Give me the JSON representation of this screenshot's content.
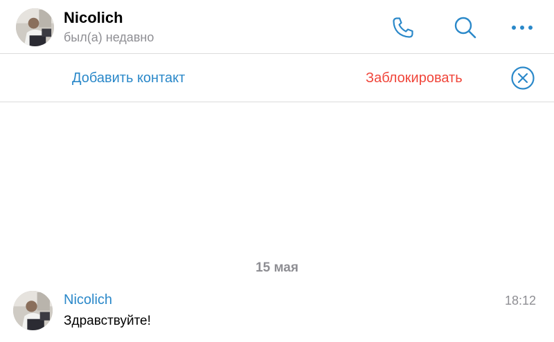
{
  "header": {
    "name": "Nicolich",
    "status": "был(а) недавно",
    "avatar_icon": "user-photo-avatar",
    "buttons": {
      "call_icon": "phone-icon",
      "search_icon": "search-icon",
      "more_icon": "more-dots-icon"
    }
  },
  "action_bar": {
    "add_contact": "Добавить контакт",
    "block": "Заблокировать",
    "close_icon": "close-circle-icon"
  },
  "chat": {
    "date_separator": "15 мая",
    "messages": [
      {
        "author": "Nicolich",
        "time": "18:12",
        "text": "Здравствуйте!"
      }
    ]
  },
  "colors": {
    "accent": "#2a88c9",
    "danger": "#f0453a",
    "secondary_text": "#8e8e93",
    "divider": "#dcdcdc"
  }
}
